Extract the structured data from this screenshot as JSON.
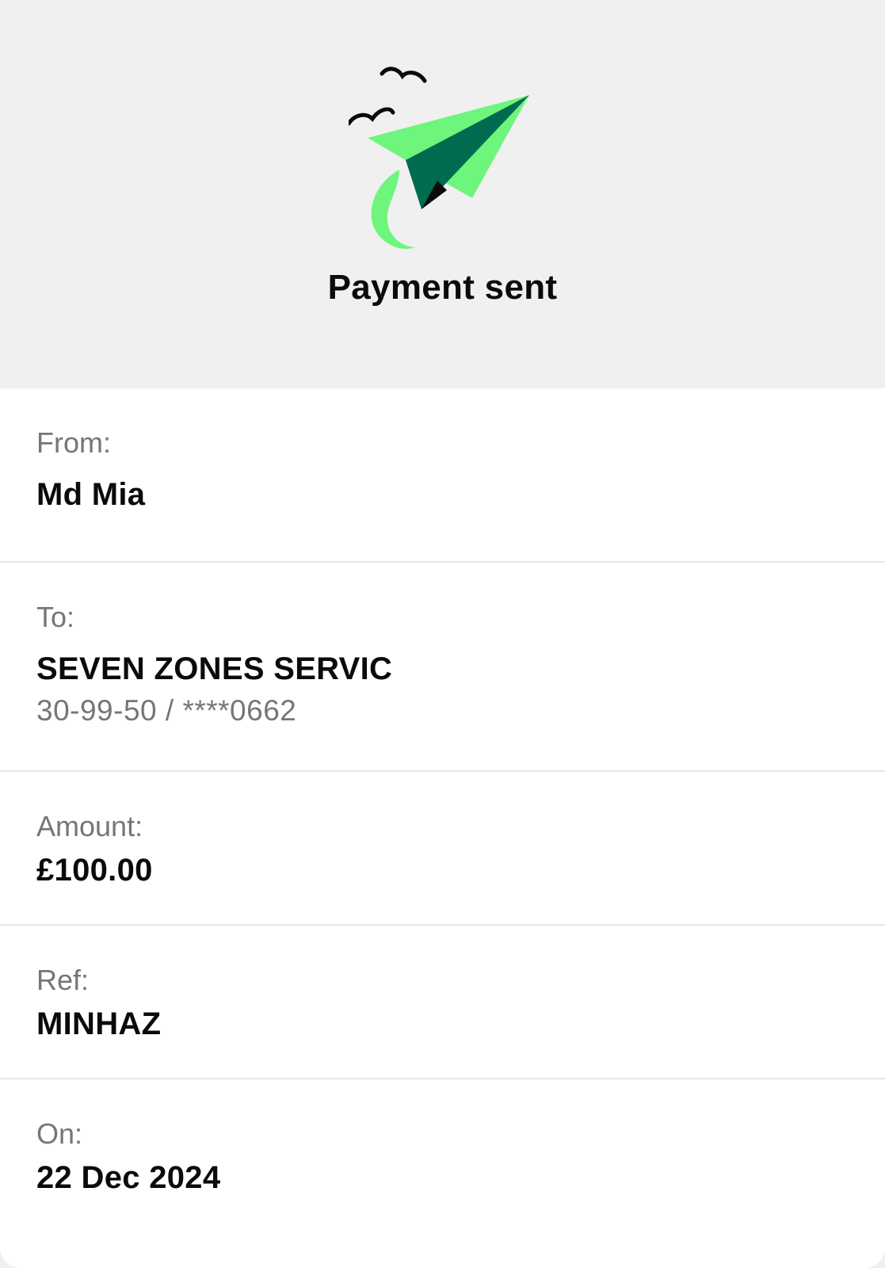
{
  "header": {
    "title": "Payment sent",
    "illustration": "paper-plane-icon",
    "colors": {
      "background": "#f0f0f0",
      "plane_light": "#6ef57c",
      "plane_dark": "#006b4f"
    }
  },
  "details": {
    "from": {
      "label": "From:",
      "value": "Md Mia"
    },
    "to": {
      "label": "To:",
      "value": "SEVEN ZONES SERVIC",
      "account": "30-99-50 / ****0662"
    },
    "amount": {
      "label": "Amount:",
      "value": "£100.00"
    },
    "ref": {
      "label": "Ref:",
      "value": "MINHAZ"
    },
    "on": {
      "label": "On:",
      "value": "22 Dec 2024"
    }
  }
}
